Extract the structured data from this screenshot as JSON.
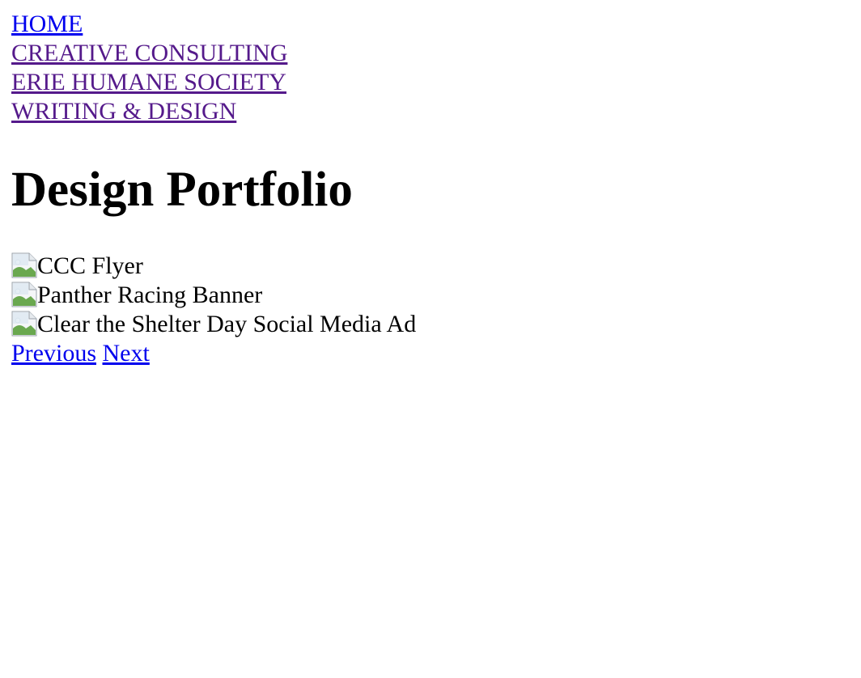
{
  "nav": {
    "items": [
      {
        "label": "HOME"
      },
      {
        "label": "CREATIVE CONSULTING"
      },
      {
        "label": "ERIE HUMANE SOCIETY"
      },
      {
        "label": "WRITING & DESIGN"
      }
    ]
  },
  "main": {
    "title": "Design Portfolio",
    "slides": [
      {
        "alt": "CCC Flyer",
        "icon": "broken-image-icon"
      },
      {
        "alt": "Panther Racing Banner",
        "icon": "broken-image-icon"
      },
      {
        "alt": "Clear the Shelter Day Social Media Ad",
        "icon": "broken-image-icon"
      }
    ],
    "pager": {
      "previous_label": "Previous",
      "next_label": "Next"
    }
  },
  "colors": {
    "link": "#0000ee",
    "visited_link": "#551a8b",
    "text": "#000000",
    "background": "#ffffff"
  }
}
